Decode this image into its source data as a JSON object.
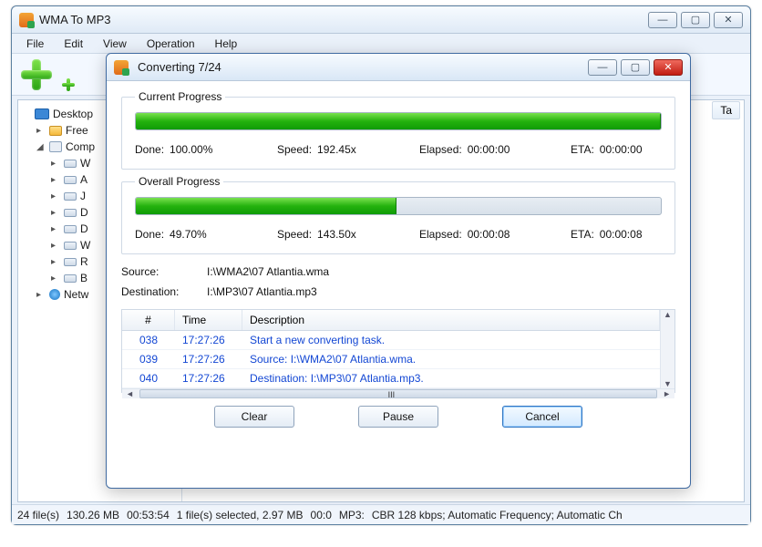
{
  "main": {
    "title": "WMA To MP3",
    "menus": [
      "File",
      "Edit",
      "View",
      "Operation",
      "Help"
    ],
    "tree": [
      {
        "indent": 0,
        "twisty": "",
        "icon": "monitor",
        "label": "Desktop"
      },
      {
        "indent": 1,
        "twisty": "▸",
        "icon": "folder",
        "label": "Free"
      },
      {
        "indent": 1,
        "twisty": "◢",
        "icon": "comp",
        "label": "Comp"
      },
      {
        "indent": 2,
        "twisty": "▸",
        "icon": "drive",
        "label": "W"
      },
      {
        "indent": 2,
        "twisty": "▸",
        "icon": "drive",
        "label": "A"
      },
      {
        "indent": 2,
        "twisty": "▸",
        "icon": "drive",
        "label": "J"
      },
      {
        "indent": 2,
        "twisty": "▸",
        "icon": "drive",
        "label": "D"
      },
      {
        "indent": 2,
        "twisty": "▸",
        "icon": "drive",
        "label": "D"
      },
      {
        "indent": 2,
        "twisty": "▸",
        "icon": "drive",
        "label": "W"
      },
      {
        "indent": 2,
        "twisty": "▸",
        "icon": "drive",
        "label": "R"
      },
      {
        "indent": 2,
        "twisty": "▸",
        "icon": "drive",
        "label": "B"
      },
      {
        "indent": 1,
        "twisty": "▸",
        "icon": "net",
        "label": "Netw"
      }
    ],
    "right_tabs": [
      "Ta"
    ],
    "status": {
      "files": "24 file(s)",
      "size": "130.26 MB",
      "dur": "00:53:54",
      "selected": "1 file(s) selected, 2.97 MB",
      "seltime": "00:0",
      "fmt": "MP3:",
      "settings": "CBR 128 kbps; Automatic Frequency; Automatic Ch"
    }
  },
  "dialog": {
    "title": "Converting 7/24",
    "current": {
      "legend": "Current Progress",
      "percent": 100.0,
      "done_label": "Done:",
      "done_val": "100.00%",
      "speed_label": "Speed:",
      "speed_val": "192.45x",
      "elapsed_label": "Elapsed:",
      "elapsed_val": "00:00:00",
      "eta_label": "ETA:",
      "eta_val": "00:00:00"
    },
    "overall": {
      "legend": "Overall Progress",
      "percent": 49.7,
      "done_label": "Done:",
      "done_val": "49.70%",
      "speed_label": "Speed:",
      "speed_val": "143.50x",
      "elapsed_label": "Elapsed:",
      "elapsed_val": "00:00:08",
      "eta_label": "ETA:",
      "eta_val": "00:00:08"
    },
    "source_label": "Source:",
    "source_val": "I:\\WMA2\\07 Atlantia.wma",
    "dest_label": "Destination:",
    "dest_val": "I:\\MP3\\07 Atlantia.mp3",
    "log": {
      "headers": {
        "num": "#",
        "time": "Time",
        "desc": "Description"
      },
      "rows": [
        {
          "num": "038",
          "time": "17:27:26",
          "desc": "Start a new converting task."
        },
        {
          "num": "039",
          "time": "17:27:26",
          "desc": "Source:  I:\\WMA2\\07 Atlantia.wma."
        },
        {
          "num": "040",
          "time": "17:27:26",
          "desc": "Destination: I:\\MP3\\07 Atlantia.mp3."
        }
      ],
      "thumb_marker": "III"
    },
    "buttons": {
      "clear": "Clear",
      "pause": "Pause",
      "cancel": "Cancel"
    }
  }
}
